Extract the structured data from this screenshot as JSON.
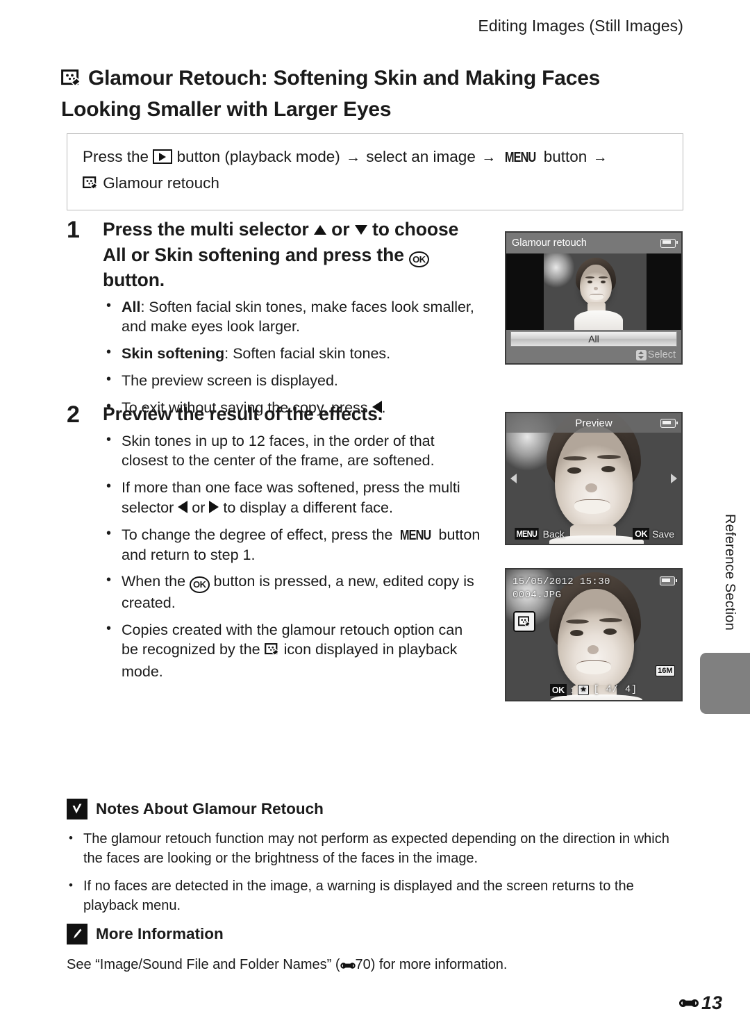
{
  "header": {
    "running_head": "Editing Images (Still Images)"
  },
  "title": {
    "icon": "glamour-retouch-icon",
    "line1": "Glamour Retouch: Softening Skin and Making Faces",
    "line2": "Looking Smaller with Larger Eyes"
  },
  "path_box": {
    "seg1": "Press the",
    "seg2": "button (playback mode)",
    "arrow": "→",
    "seg3": "select an image",
    "seg4": "button",
    "menu_label": "MENU",
    "seg5": "Glamour retouch"
  },
  "steps": [
    {
      "number": "1",
      "head_a": "Press the multi selector",
      "head_or": "or",
      "head_b": "to choose",
      "head_all": "All",
      "head_c": "or",
      "head_skin": "Skin softening",
      "head_d": "and press the",
      "head_e": "button.",
      "bullets": [
        {
          "bold": "All",
          "text": ": Soften facial skin tones, make faces look smaller, and make eyes look larger."
        },
        {
          "bold": "Skin softening",
          "text": ": Soften facial skin tones."
        },
        {
          "bold": "",
          "text": "The preview screen is displayed."
        },
        {
          "bold": "",
          "text": "To exit without saving the copy, press"
        }
      ]
    },
    {
      "number": "2",
      "head": "Preview the result of the effects.",
      "bullets": [
        "Skin tones in up to 12 faces, in the order of that closest to the center of the frame, are softened.",
        "If more than one face was softened, press the multi selector",
        "To change the degree of effect, press the",
        "When the",
        "Copies created with the glamour retouch option can be recognized by the"
      ],
      "b2_tail": "to display a different face.",
      "b2_or": "or",
      "b3_tail": "button and return to step 1.",
      "b4_tail": "button is pressed, a new, edited copy is created.",
      "b5_tail": "icon displayed in playback mode."
    }
  ],
  "screens": {
    "shot1": {
      "title": "Glamour retouch",
      "option_label": "All",
      "select_hint": "Select"
    },
    "shot2": {
      "title": "Preview",
      "menu_chip": "MENU",
      "back_label": "Back",
      "ok_chip": "OK",
      "save_label": "Save"
    },
    "shot3": {
      "datetime": "15/05/2012 15:30",
      "filename": "0004.JPG",
      "size_badge": "16M",
      "ok_chip": "OK",
      "colon": ":",
      "star": "★",
      "counter": "[    4/    4]"
    }
  },
  "side": {
    "label": "Reference Section"
  },
  "notes": {
    "title": "Notes About Glamour Retouch",
    "icon": "caution-check-icon",
    "bullets": [
      "The glamour retouch function may not perform as expected depending on the direction in which the faces are looking or the brightness of the faces in the image.",
      "If no faces are detected in the image, a warning is displayed and the screen returns to the playback menu."
    ]
  },
  "more_info": {
    "title": "More Information",
    "icon": "pencil-icon",
    "text_a": "See “Image/Sound File and Folder Names” (",
    "text_b": "70) for more information."
  },
  "footer": {
    "page_number": "13"
  }
}
